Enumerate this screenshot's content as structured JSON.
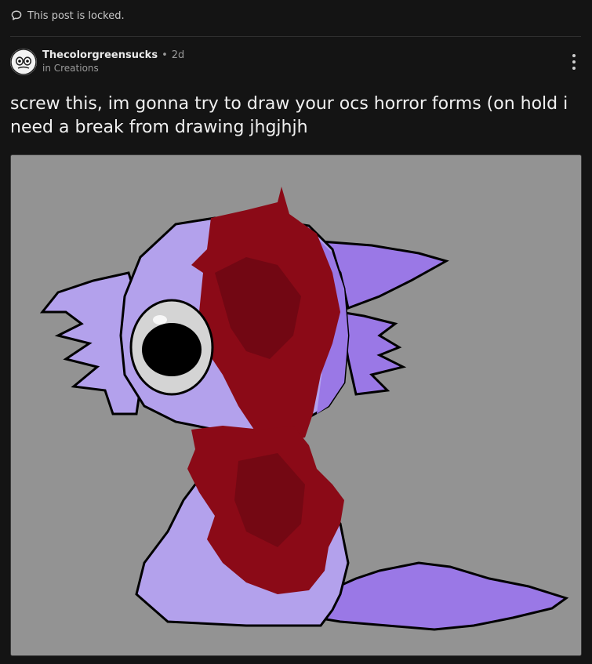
{
  "locked_notice": {
    "text": "This post is locked.",
    "icon": "speech-bubble-icon"
  },
  "post": {
    "author": "Thecolorgreensucks",
    "separator": "•",
    "age": "2d",
    "community": "in Creations",
    "title": "screw this, im gonna try to draw your ocs horror forms (on hold i need a break from drawing jhgjhjh",
    "more_icon": "more-vertical-icon"
  },
  "image": {
    "description_icon": "drawing-image",
    "colors": {
      "background": "#939393",
      "body_light": "#b3a1ec",
      "body_dark": "#9a78e6",
      "blood": "#8b0a17",
      "eye_outer": "#d4d4d4",
      "eye_pupil": "#000000"
    }
  }
}
